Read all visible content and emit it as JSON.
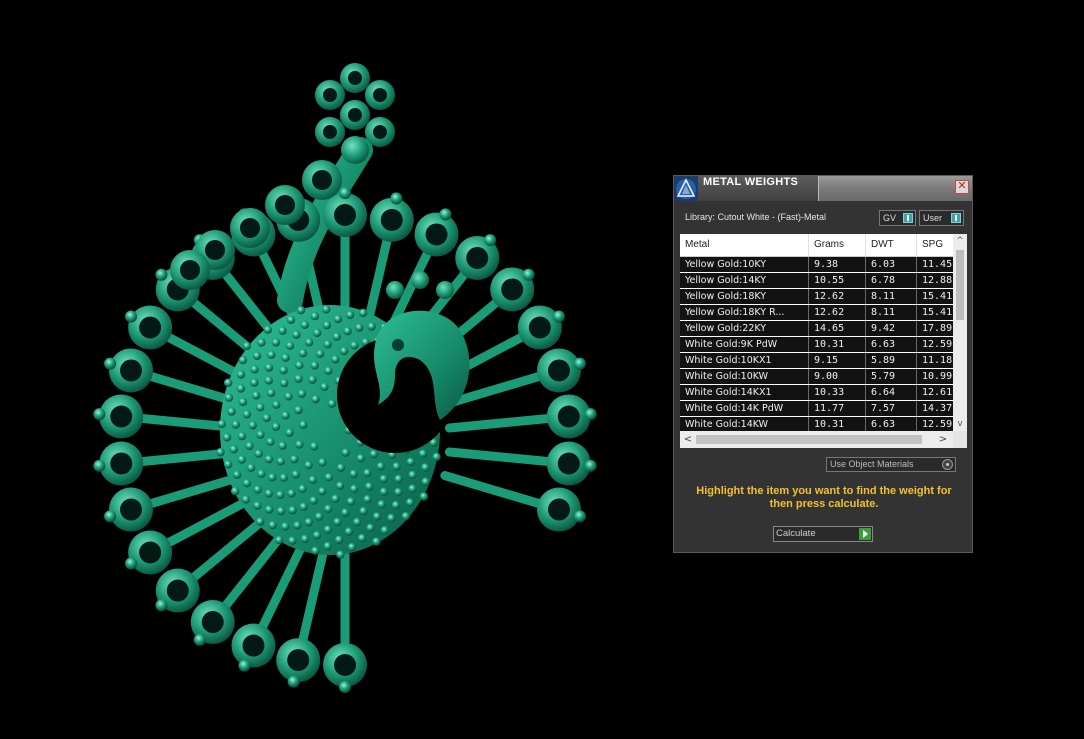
{
  "window": {
    "title": "METAL WEIGHTS",
    "close_glyph": "✕",
    "icons": {
      "logo": "triangle-logo-icon",
      "close": "close-icon"
    }
  },
  "library": {
    "label": "Library: Cutout White - (Fast)-Metal",
    "gv_label": "GV",
    "user_label": "User"
  },
  "table": {
    "headers": [
      "Metal",
      "Grams",
      "DWT",
      "SPG"
    ],
    "rows": [
      [
        "Yellow Gold:10KY",
        "9.38",
        "6.03",
        "11.45"
      ],
      [
        "Yellow Gold:14KY",
        "10.55",
        "6.78",
        "12.88"
      ],
      [
        "Yellow Gold:18KY",
        "12.62",
        "8.11",
        "15.41"
      ],
      [
        "Yellow Gold:18KY R...",
        "12.62",
        "8.11",
        "15.41"
      ],
      [
        "Yellow Gold:22KY",
        "14.65",
        "9.42",
        "17.89"
      ],
      [
        "White Gold:9K PdW",
        "10.31",
        "6.63",
        "12.59"
      ],
      [
        "White Gold:10KX1",
        "9.15",
        "5.89",
        "11.18"
      ],
      [
        "White Gold:10KW",
        "9.00",
        "5.79",
        "10.99"
      ],
      [
        "White Gold:14KX1",
        "10.33",
        "6.64",
        "12.61"
      ],
      [
        "White Gold:14K PdW",
        "11.77",
        "7.57",
        "14.37"
      ],
      [
        "White Gold:14KW",
        "10.31",
        "6.63",
        "12.59"
      ]
    ],
    "scroll_up_glyph": "^",
    "scroll_down_glyph": "v",
    "scroll_left_glyph": "<",
    "scroll_right_glyph": ">"
  },
  "options": {
    "use_object_materials": "Use Object Materials"
  },
  "hint": "Highlight the item you want to find the weight for then press calculate.",
  "calculate_label": "Calculate",
  "colors": {
    "model_green": "#1a9a78",
    "hint_yellow": "#f2c22c",
    "panel_bg": "#333333"
  }
}
